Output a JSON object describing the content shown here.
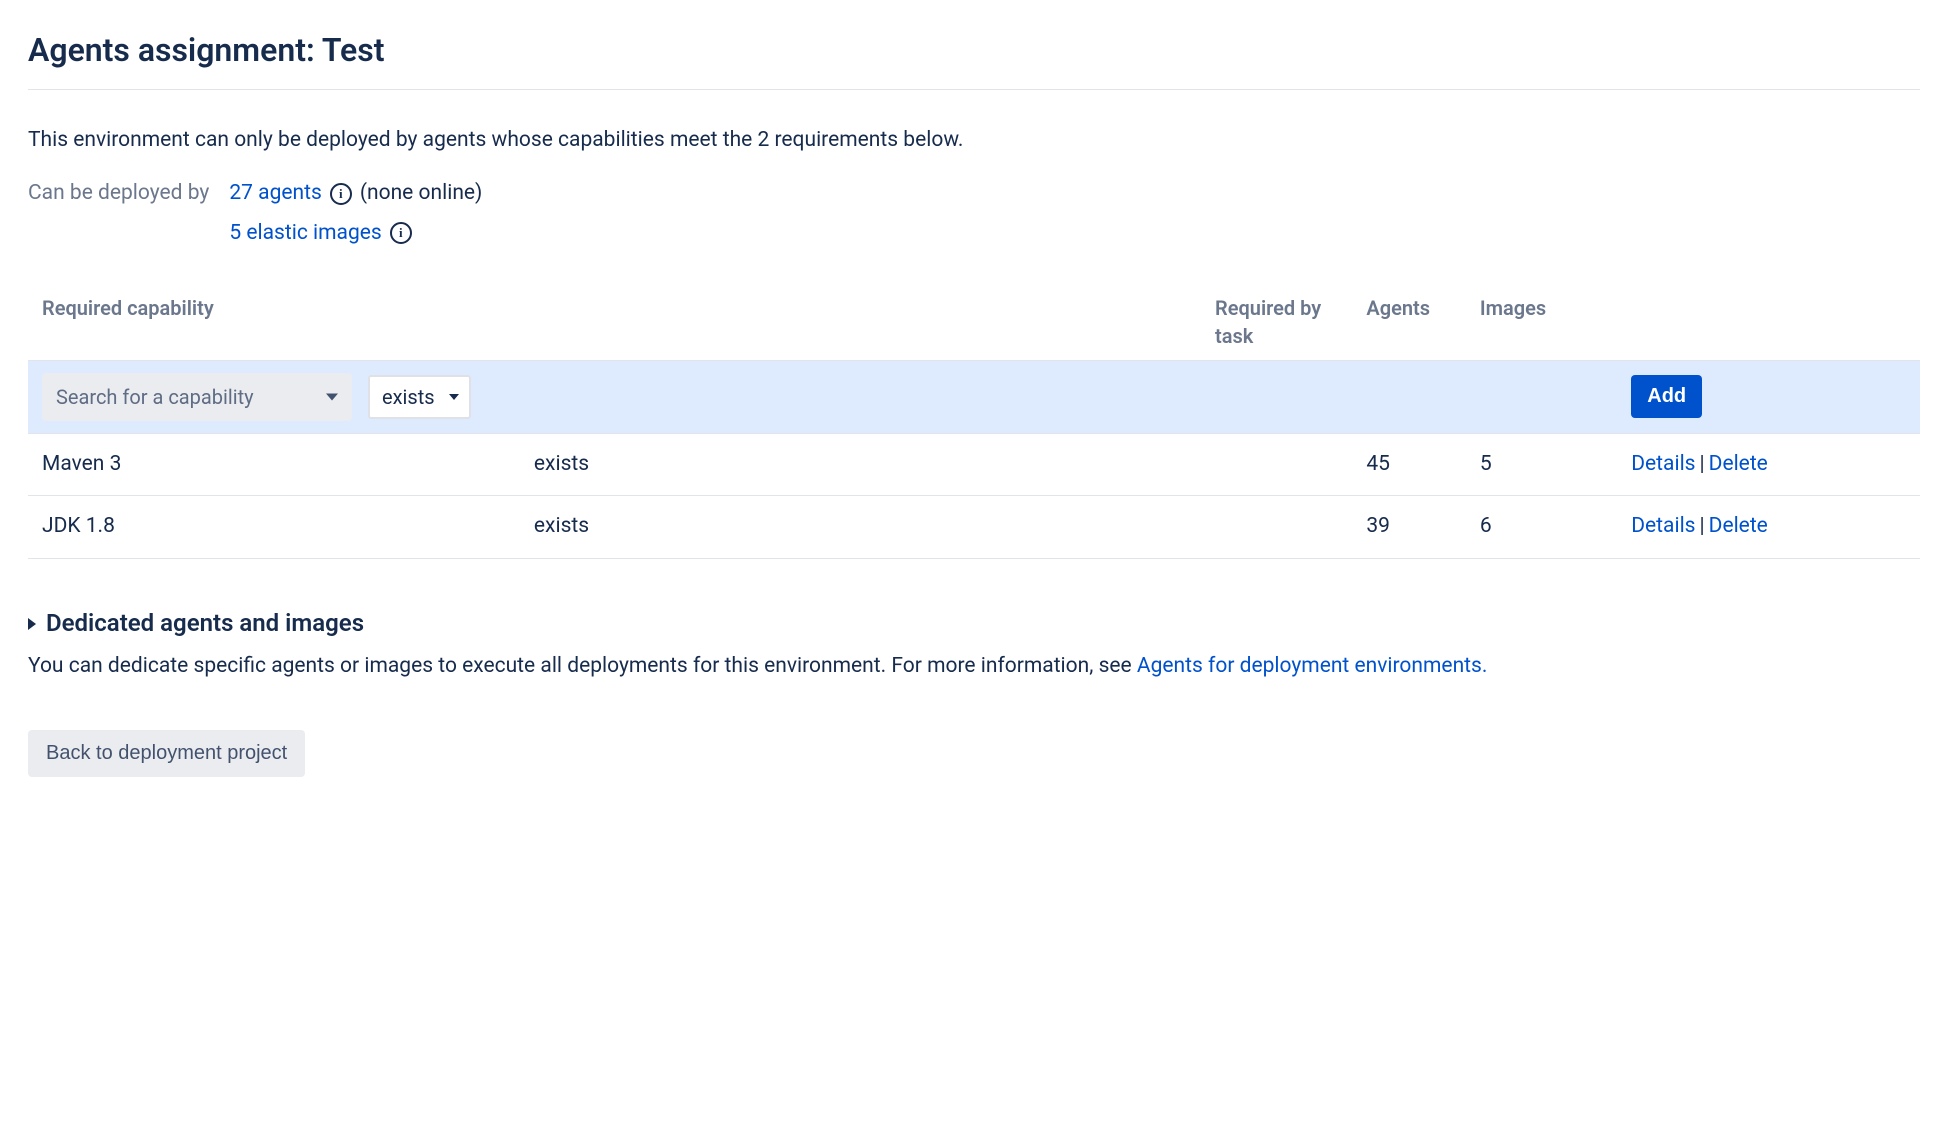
{
  "page": {
    "title": "Agents assignment: Test",
    "description": "This environment can only be deployed by agents whose capabilities meet the 2 requirements below."
  },
  "deploy": {
    "label": "Can be deployed by",
    "agents_link": "27 agents",
    "agents_status": "(none online)",
    "elastic_link": "5 elastic images"
  },
  "table": {
    "headers": {
      "capability": "Required capability",
      "required_by_task": "Required by task",
      "agents": "Agents",
      "images": "Images"
    },
    "filter": {
      "search_placeholder": "Search for a capability",
      "condition": "exists",
      "add_label": "Add"
    },
    "rows": [
      {
        "capability": "Maven 3",
        "condition": "exists",
        "required_by_task": "",
        "agents": "45",
        "images": "5"
      },
      {
        "capability": "JDK 1.8",
        "condition": "exists",
        "required_by_task": "",
        "agents": "39",
        "images": "6"
      }
    ],
    "actions": {
      "details": "Details",
      "delete": "Delete"
    }
  },
  "dedicated": {
    "title": "Dedicated agents and images",
    "body_prefix": "You can dedicate specific agents or images to execute all deployments for this environment. For more information, see ",
    "link": "Agents for deployment environments.",
    "body_suffix": ""
  },
  "back_label": "Back to deployment project"
}
